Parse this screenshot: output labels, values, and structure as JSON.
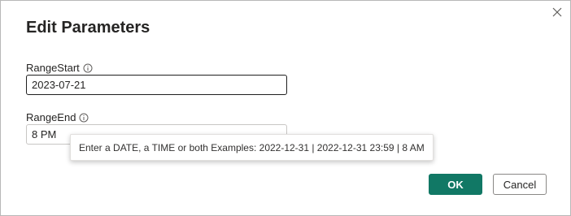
{
  "dialog": {
    "title": "Edit Parameters",
    "close_icon": "close-icon"
  },
  "params": [
    {
      "label": "RangeStart",
      "info_icon": "info-icon",
      "value": "2023-07-21"
    },
    {
      "label": "RangeEnd",
      "info_icon": "info-icon",
      "value": "8 PM"
    }
  ],
  "tooltip": {
    "text": "Enter a DATE, a TIME or both Examples: 2022-12-31 | 2022-12-31 23:59 | 8 AM"
  },
  "buttons": {
    "ok_label": "OK",
    "cancel_label": "Cancel"
  },
  "colors": {
    "primary": "#117865",
    "text": "#252423"
  }
}
